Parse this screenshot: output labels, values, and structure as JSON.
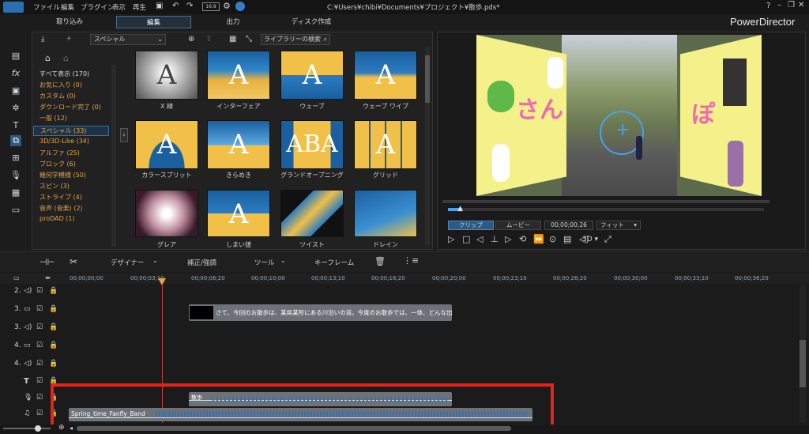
{
  "title": {
    "menus": [
      "ファイル",
      "編集",
      "プラグイン",
      "表示",
      "再生"
    ],
    "path": "C:¥Users¥chibi¥Documents¥プロジェクト¥散歩.pds*",
    "help": "?"
  },
  "tabs": [
    "取り込み",
    "編集",
    "出力",
    "ディスク作成"
  ],
  "brand": "PowerDirector",
  "library": {
    "dropdown": "スペシャル",
    "search_placeholder": "ライブラリーの検索",
    "categories": [
      "すべて表示 (170)",
      "お気に入り (0)",
      "カスタム (0)",
      "ダウンロード完了 (0)",
      "一般 (12)",
      "スペシャル (33)",
      "3D/3D-Like (34)",
      "アルファ (25)",
      "ブロック (6)",
      "幾何学模様 (50)",
      "スピン (3)",
      "ストライプ (4)",
      "音声 (音楽) (2)",
      "proDAD (1)"
    ],
    "transitions": [
      "X 線",
      "インターフェア",
      "ウェーブ",
      "ウェーブ ワイプ",
      "カラースプリット",
      "きらめき",
      "グランドオープニング",
      "グリッド",
      "グレア",
      "しまい値",
      "ツイスト",
      "ドレイン"
    ],
    "thumb_letter": "A"
  },
  "preview": {
    "mode_clip": "クリップ",
    "mode_movie": "ムービー",
    "timecode": "00;00;00;26",
    "fit": "フィット",
    "three_d": "3D",
    "overlay_text_left": "さん",
    "overlay_text_right": "ぽ"
  },
  "toolbar": {
    "designer": "デザイナー",
    "correction": "補正/強調",
    "tools": "ツール",
    "keyframe": "キーフレーム"
  },
  "ruler": [
    "00;00;00;00",
    "00;00;03;10",
    "00;00;06;20",
    "00;00;10;00",
    "00;00;13;10",
    "00;00;16;20",
    "00;00;20;00",
    "00;00;23;10",
    "00;00;26;20",
    "00;00;30;00",
    "00;00;33;10",
    "00;00;36;20"
  ],
  "tracks": [
    "2.",
    "3.",
    "3.",
    "4.",
    "4.",
    "T",
    "",
    ""
  ],
  "clips": {
    "subtitle": "さて、今回のお散歩は、某県某所にある川沿いの道。今度のお散歩では、一体、どんな出会いが",
    "voice": "散歩",
    "music": "Spring_time_Fanfly_Band"
  },
  "colors": {
    "accent": "#2b6ea8",
    "highlight": "#e8211b",
    "gold": "#e0a44a"
  }
}
